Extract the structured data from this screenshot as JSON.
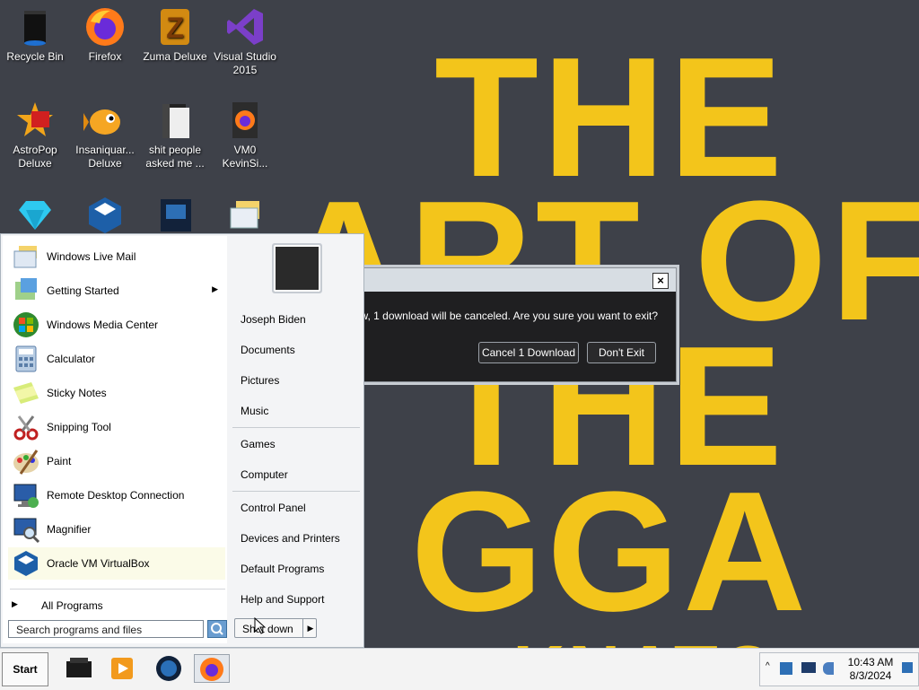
{
  "wallpaper": {
    "lines": [
      "THE",
      "ART OF",
      "THE",
      "GGA",
      "KNATO"
    ]
  },
  "desktop_icons": [
    {
      "label": "Recycle Bin"
    },
    {
      "label": "Firefox"
    },
    {
      "label": "Zuma Deluxe"
    },
    {
      "label": "Visual Studio 2015"
    },
    {
      "label": "AstroPop Deluxe"
    },
    {
      "label": "Insaniquar... Deluxe"
    },
    {
      "label": "shit people asked me ..."
    },
    {
      "label": "VM0 KevinSi..."
    }
  ],
  "dialog": {
    "message": "w, 1 download will be canceled. Are you sure you want to exit?",
    "cancel_download": "Cancel 1 Download",
    "dont_exit": "Don't Exit",
    "close": "×"
  },
  "start_menu": {
    "programs": [
      {
        "label": "Windows Live Mail"
      },
      {
        "label": "Getting Started",
        "arrow": "▶"
      },
      {
        "label": "Windows Media Center"
      },
      {
        "label": "Calculator"
      },
      {
        "label": "Sticky Notes"
      },
      {
        "label": "Snipping Tool"
      },
      {
        "label": "Paint"
      },
      {
        "label": "Remote Desktop Connection"
      },
      {
        "label": "Magnifier"
      },
      {
        "label": "Oracle VM VirtualBox"
      }
    ],
    "all_programs": "All Programs",
    "search_placeholder": "Search programs and files",
    "right": {
      "user": "Joseph Biden",
      "documents": "Documents",
      "pictures": "Pictures",
      "music": "Music",
      "games": "Games",
      "computer": "Computer",
      "control_panel": "Control Panel",
      "devices": "Devices and Printers",
      "default_programs": "Default Programs",
      "help": "Help and Support"
    },
    "shutdown": "Shut down"
  },
  "taskbar": {
    "start": "Start",
    "time": "10:43 AM",
    "date": "8/3/2024"
  }
}
